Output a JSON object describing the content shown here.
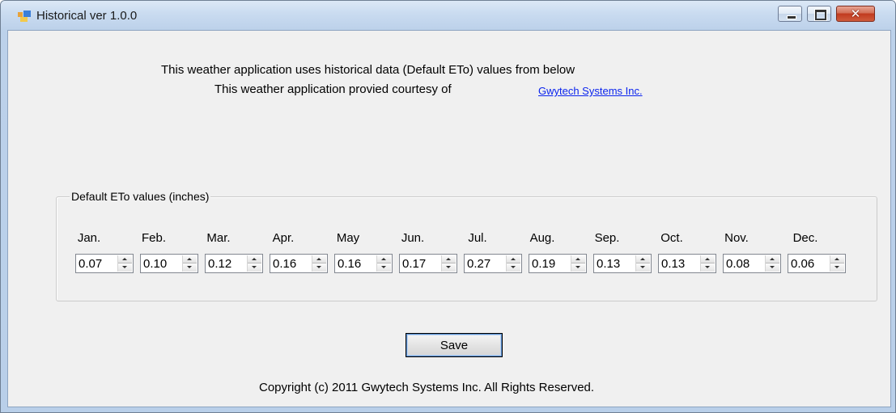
{
  "window": {
    "title": "Historical ver 1.0.0",
    "close_glyph": "✕"
  },
  "intro": {
    "line1": "This weather application uses historical data (Default ETo) values from below",
    "line2": "This weather application provied courtesy of",
    "link": "Gwytech Systems Inc."
  },
  "group": {
    "legend": "Default ETo values (inches)",
    "months": [
      {
        "label": "Jan.",
        "value": "0.07"
      },
      {
        "label": "Feb.",
        "value": "0.10"
      },
      {
        "label": "Mar.",
        "value": "0.12"
      },
      {
        "label": "Apr.",
        "value": "0.16"
      },
      {
        "label": "May",
        "value": "0.16"
      },
      {
        "label": "Jun.",
        "value": "0.17"
      },
      {
        "label": "Jul.",
        "value": "0.27"
      },
      {
        "label": "Aug.",
        "value": "0.19"
      },
      {
        "label": "Sep.",
        "value": "0.13"
      },
      {
        "label": "Oct.",
        "value": "0.13"
      },
      {
        "label": "Nov.",
        "value": "0.08"
      },
      {
        "label": "Dec.",
        "value": "0.06"
      }
    ]
  },
  "save_label": "Save",
  "copyright": "Copyright (c) 2011 Gwytech Systems Inc. All Rights Reserved.",
  "colors": {
    "link": "#0b24ee",
    "titlebar": "#bcd1ea",
    "close_button": "#c13a1f"
  },
  "icons": [
    "app-icon",
    "minimize-icon",
    "maximize-icon",
    "close-icon",
    "spin-up-icon",
    "spin-down-icon"
  ]
}
